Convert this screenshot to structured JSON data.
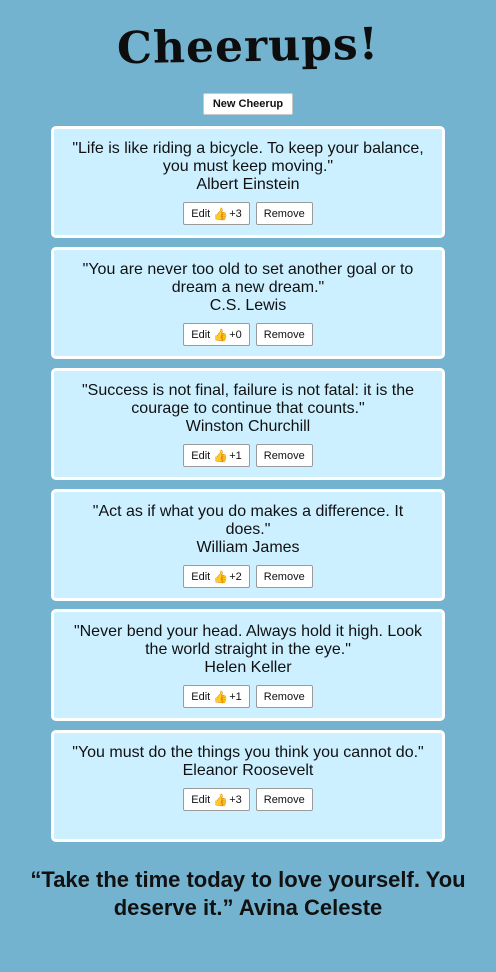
{
  "app": {
    "title": "Cheerups!",
    "new_button_label": "New Cheerup"
  },
  "cards": [
    {
      "quote": "\"Life is like riding a bicycle. To keep your balance, you must keep moving.\"",
      "author": "Albert Einstein",
      "edit_label": "Edit",
      "thumb_icon": "thumbs-up-icon",
      "vote_count": "+3",
      "remove_label": "Remove"
    },
    {
      "quote": "\"You are never too old to set another goal or to dream a new dream.\"",
      "author": "C.S. Lewis",
      "edit_label": "Edit",
      "thumb_icon": "thumbs-up-icon",
      "vote_count": "+0",
      "remove_label": "Remove"
    },
    {
      "quote": "\"Success is not final, failure is not fatal: it is the courage to continue that counts.\"",
      "author": "Winston Churchill",
      "edit_label": "Edit",
      "thumb_icon": "thumbs-up-icon",
      "vote_count": "+1",
      "remove_label": "Remove"
    },
    {
      "quote": "\"Act as if what you do makes a difference. It does.\"",
      "author": "William James",
      "edit_label": "Edit",
      "thumb_icon": "thumbs-up-icon",
      "vote_count": "+2",
      "remove_label": "Remove"
    },
    {
      "quote": "\"Never bend your head. Always hold it high. Look the world straight in the eye.\"",
      "author": "Helen Keller",
      "edit_label": "Edit",
      "thumb_icon": "thumbs-up-icon",
      "vote_count": "+1",
      "remove_label": "Remove"
    },
    {
      "quote": "\"You must do the things you think you cannot do.\"",
      "author": "Eleanor Roosevelt",
      "edit_label": "Edit",
      "thumb_icon": "thumbs-up-icon",
      "vote_count": "+3",
      "remove_label": "Remove"
    }
  ],
  "footer": {
    "quote": "“Take the time today to love yourself. You deserve it.” Avina Celeste"
  },
  "colors": {
    "background": "#74b3cf",
    "card_background": "#ccf0ff",
    "card_border": "#ffffff"
  }
}
